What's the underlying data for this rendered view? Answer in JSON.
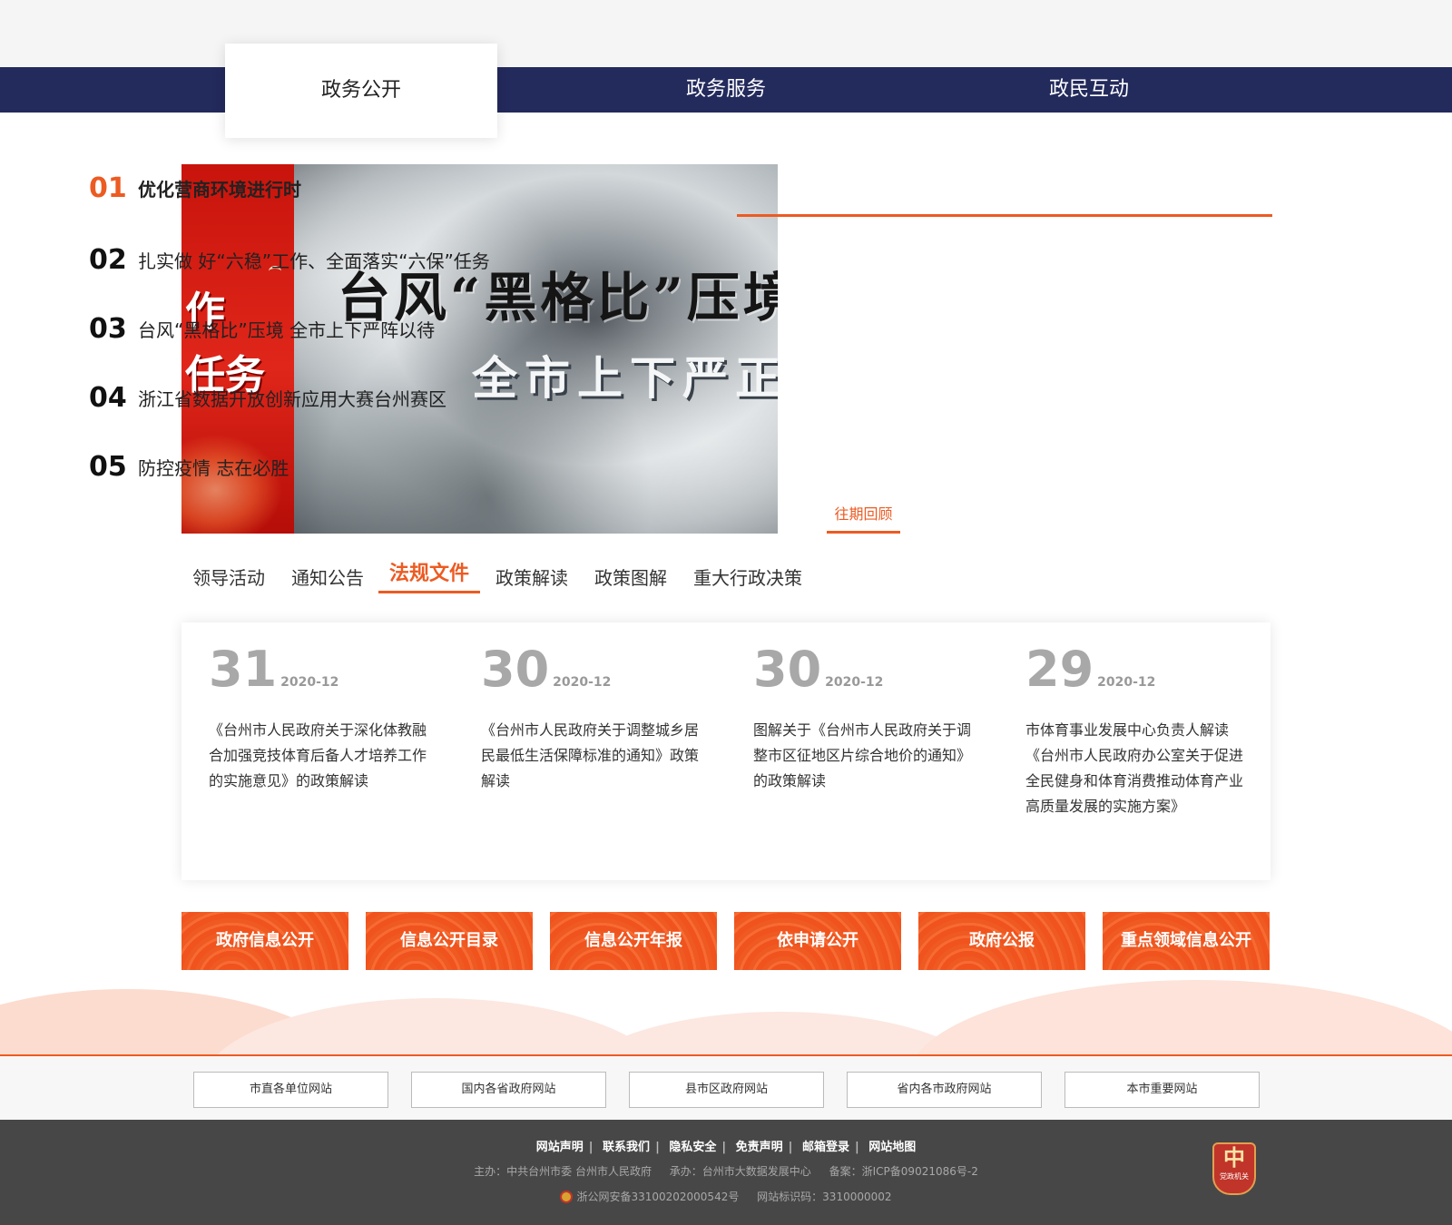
{
  "nav": {
    "tabs": [
      "政务公开",
      "政务服务",
      "政民互动"
    ]
  },
  "banner": {
    "left_text": [
      "作",
      "任务"
    ],
    "title1": "台风“黑格比”压境",
    "title2": "全市上下严正以"
  },
  "headlines": {
    "items": [
      {
        "num": "01",
        "title": "优化营商环境进行时"
      },
      {
        "num": "02",
        "title": "扎实做 好“六稳”工作、全面落实“六保”任务"
      },
      {
        "num": "03",
        "title": "台风“黑格比”压境 全市上下严阵以待"
      },
      {
        "num": "04",
        "title": "浙江省数据开放创新应用大赛台州赛区"
      },
      {
        "num": "05",
        "title": "防控疫情 志在必胜"
      }
    ],
    "past_link": "往期回顾"
  },
  "sub_tabs": [
    "领导活动",
    "通知公告",
    "法规文件",
    "政策解读",
    "政策图解",
    "重大行政决策"
  ],
  "cards": [
    {
      "day": "31",
      "ym": "2020-12",
      "text": "《台州市人民政府关于深化体教融合加强竞技体育后备人才培养工作的实施意见》的政策解读"
    },
    {
      "day": "30",
      "ym": "2020-12",
      "text": "《台州市人民政府关于调整城乡居民最低生活保障标准的通知》政策解读"
    },
    {
      "day": "30",
      "ym": "2020-12",
      "text": "图解关于《台州市人民政府关于调整市区征地区片综合地价的通知》的政策解读"
    },
    {
      "day": "29",
      "ym": "2020-12",
      "text": "市体育事业发展中心负责人解读《台州市人民政府办公室关于促进全民健身和体育消费推动体育产业高质量发展的实施方案》"
    }
  ],
  "quick_buttons": [
    "政府信息公开",
    "信息公开目录",
    "信息公开年报",
    "依申请公开",
    "政府公报",
    "重点领域信息公开"
  ],
  "site_links": [
    "市直各单位网站",
    "国内各省政府网站",
    "县市区政府网站",
    "省内各市政府网站",
    "本市重要网站"
  ],
  "footer": {
    "links": [
      "网站声明",
      "联系我们",
      "隐私安全",
      "免责声明",
      "邮箱登录",
      "网站地图"
    ],
    "host": "主办：中共台州市委 台州市人民政府",
    "undertaker": "承办：台州市大数据发展中心",
    "icp": "备案：浙ICP备09021086号-2",
    "police": "浙公网安备33100202000542号",
    "site_code": "网站标识码：3310000002",
    "badge_label": "党政机关"
  },
  "colors": {
    "nav_bg": "#232a5c",
    "accent": "#ec5b22",
    "footer_bg": "#474747"
  }
}
